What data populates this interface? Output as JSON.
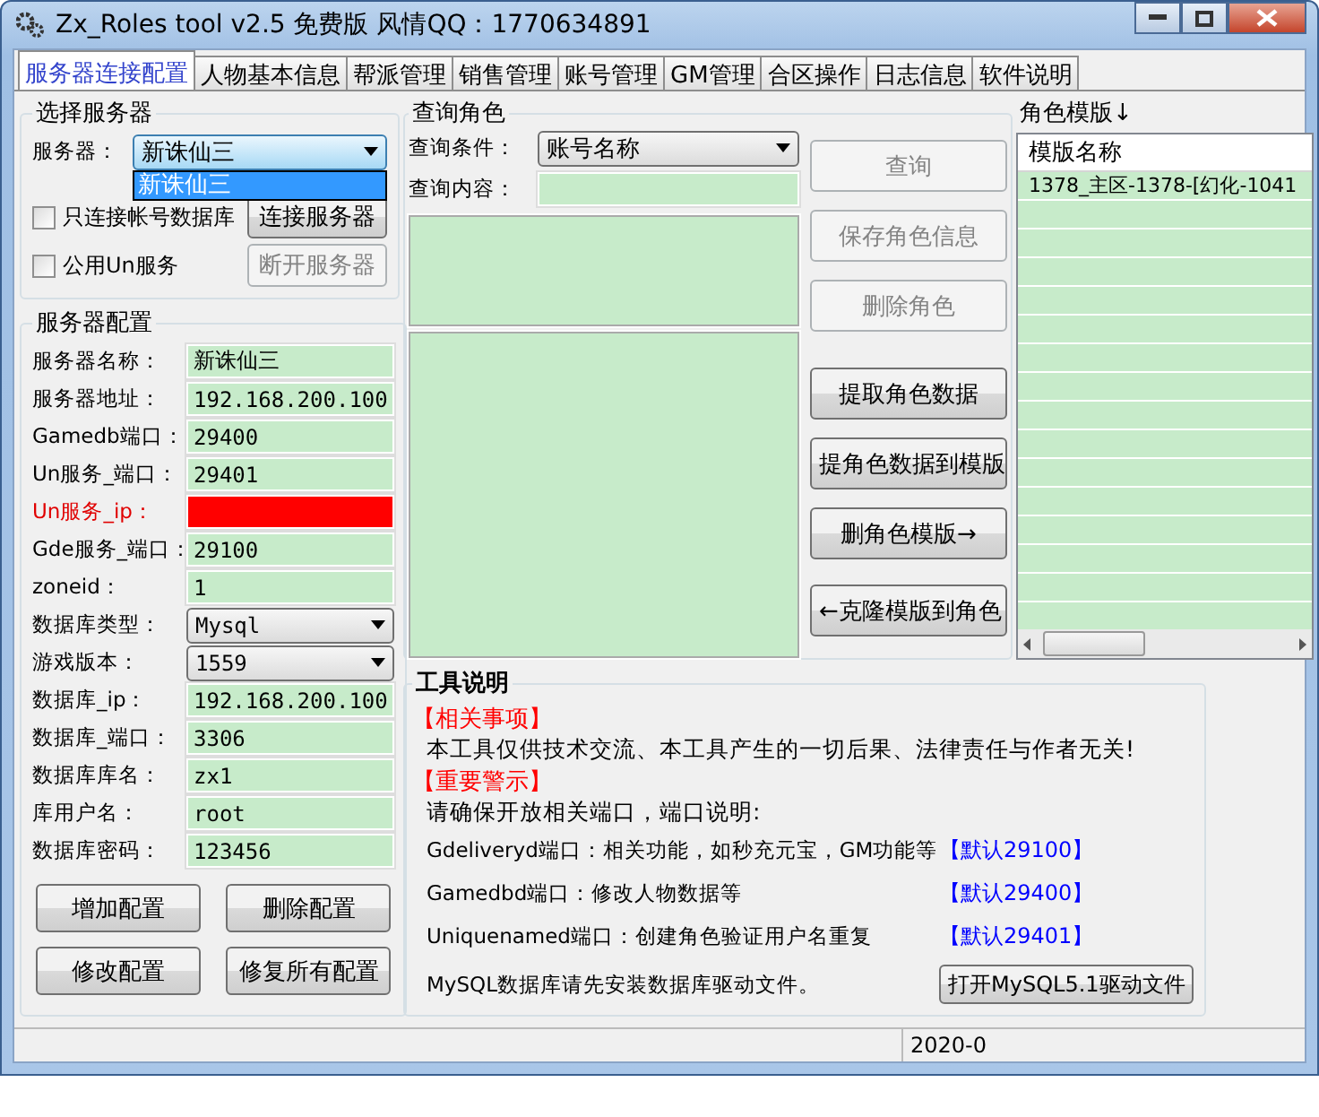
{
  "window": {
    "title": "Zx_Roles tool v2.5 免费版 风情QQ：1770634891"
  },
  "tabs": [
    {
      "label": "服务器连接配置",
      "selected": true
    },
    {
      "label": "人物基本信息",
      "selected": false
    },
    {
      "label": "帮派管理",
      "selected": false
    },
    {
      "label": "销售管理",
      "selected": false
    },
    {
      "label": "账号管理",
      "selected": false
    },
    {
      "label": "GM管理",
      "selected": false
    },
    {
      "label": "合区操作",
      "selected": false
    },
    {
      "label": "日志信息",
      "selected": false
    },
    {
      "label": "软件说明",
      "selected": false
    }
  ],
  "server_select": {
    "title": "选择服务器",
    "server_label": "服务器：",
    "server_value": "新诛仙三",
    "dropdown_items": [
      {
        "label": "新诛仙三",
        "selected": true
      }
    ],
    "checkboxes": [
      {
        "label": "只连接帐号数据库",
        "checked": false
      },
      {
        "label": "公用Un服务",
        "checked": false
      }
    ],
    "buttons": [
      {
        "label": "连接服务器",
        "disabled": false
      },
      {
        "label": "断开服务器",
        "disabled": true
      }
    ]
  },
  "server_config": {
    "title": "服务器配置",
    "fields": [
      {
        "label": "服务器名称：",
        "kind": "text",
        "value": "新诛仙三",
        "error": false
      },
      {
        "label": "服务器地址：",
        "kind": "text",
        "value": "192.168.200.100",
        "error": false
      },
      {
        "label": "Gamedb端口：",
        "kind": "text",
        "value": "29400",
        "error": false
      },
      {
        "label": "Un服务_端口：",
        "kind": "text",
        "value": "29401",
        "error": false
      },
      {
        "label": "Un服务_ip：",
        "kind": "text",
        "error": true
      },
      {
        "label": "Gde服务_端口：",
        "kind": "text",
        "value": "29100",
        "error": false
      },
      {
        "label": "zoneid：",
        "kind": "text",
        "value": "1",
        "error": false
      },
      {
        "label": "数据库类型：",
        "kind": "combo",
        "value": "Mysql",
        "error": false
      },
      {
        "label": "游戏版本：",
        "kind": "combo",
        "value": "1559",
        "error": false
      },
      {
        "label": "数据库_ip：",
        "kind": "text",
        "value": "192.168.200.100",
        "error": false
      },
      {
        "label": "数据库_端口：",
        "kind": "text",
        "value": "3306",
        "error": false
      },
      {
        "label": "数据库库名：",
        "kind": "text",
        "value": "zx1",
        "error": false
      },
      {
        "label": "库用户名：",
        "kind": "text",
        "value": "root",
        "error": false
      },
      {
        "label": "数据库密码：",
        "kind": "text",
        "value": "123456",
        "error": false
      }
    ],
    "buttons": [
      {
        "label": "增加配置"
      },
      {
        "label": "删除配置"
      },
      {
        "label": "修改配置"
      },
      {
        "label": "修复所有配置"
      }
    ]
  },
  "query": {
    "title": "查询角色",
    "condition_label": "查询条件：",
    "condition_value": "账号名称",
    "content_label": "查询内容：",
    "buttons": [
      {
        "label": "查询",
        "disabled": true
      },
      {
        "label": "保存角色信息",
        "disabled": true
      },
      {
        "label": "删除角色",
        "disabled": true
      },
      {
        "label": "提取角色数据",
        "disabled": false
      },
      {
        "label": "提角色数据到模版",
        "disabled": false
      },
      {
        "label": "删角色模版→",
        "disabled": false
      },
      {
        "label": "←克隆模版到角色",
        "disabled": false
      }
    ]
  },
  "templates": {
    "title": "角色模版↓",
    "column": "模版名称",
    "rows": [
      "1378_主区-1378-[幻化-1041"
    ]
  },
  "tool_info": {
    "title": "工具说明",
    "notice_heading": "【相关事项】",
    "notice": "本工具仅供技术交流、本工具产生的一切后果、法律责任与作者无关!",
    "warning_heading": "【重要警示】",
    "ports_intro": "请确保开放相关端口，端口说明:",
    "ports": [
      {
        "text": "Gdeliveryd端口：相关功能，如秒充元宝，GM功能等",
        "default": "【默认29100】"
      },
      {
        "text": "Gamedbd端口：修改人物数据等",
        "default": "【默认29400】"
      },
      {
        "text": "Uniquenamed端口：创建角色验证用户名重复",
        "default": "【默认29401】"
      }
    ],
    "driver_note": "MySQL数据库请先安装数据库驱动文件。",
    "driver_button": "打开MySQL5.1驱动文件"
  },
  "status_bar": {
    "text": "2020-0"
  }
}
